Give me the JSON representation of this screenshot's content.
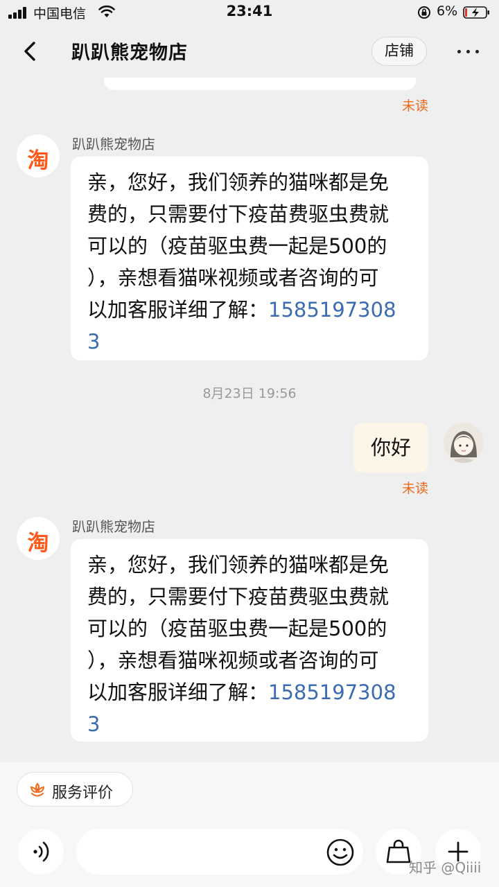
{
  "status_bar": {
    "carrier": "中国电信",
    "time": "23:41",
    "battery_percent": "6%"
  },
  "header": {
    "back_icon": "chevron-left-icon",
    "title": "趴趴熊宠物店",
    "store_button": "店铺",
    "more_icon": "more-dots-icon"
  },
  "chat": {
    "messages": [
      {
        "type": "status",
        "text": "未读"
      },
      {
        "type": "incoming",
        "sender": "趴趴熊宠物店",
        "avatar_text": "淘",
        "lines": [
          "亲，您好，我们领养的猫咪都是免",
          "费的，只需要付下疫苗费驱虫费就",
          "可以的（疫苗驱虫费一起是500的",
          "），亲想看猫咪视频或者咨询的可",
          "以加客服详细了解："
        ],
        "phone": "1585197308",
        "phone_tail": "3"
      },
      {
        "type": "timestamp",
        "text": "8月23日 19:56"
      },
      {
        "type": "outgoing",
        "text": "你好",
        "status": "未读"
      },
      {
        "type": "incoming",
        "sender": "趴趴熊宠物店",
        "avatar_text": "淘",
        "lines": [
          "亲，您好，我们领养的猫咪都是免",
          "费的，只需要付下疫苗费驱虫费就",
          "可以的（疫苗驱虫费一起是500的",
          "），亲想看猫咪视频或者咨询的可",
          "以加客服详细了解："
        ],
        "phone": "1585197308",
        "phone_tail": "3"
      }
    ]
  },
  "bottom": {
    "service_eval": "服务评价",
    "service_eval_icon": "flower-badge-icon",
    "voice_icon": "voice-icon",
    "emoji_icon": "smiley-icon",
    "bag_icon": "shopping-bag-icon",
    "plus_icon": "plus-icon",
    "watermark": "知乎 @Qiiii"
  },
  "colors": {
    "accent_orange": "#f06a1b",
    "link_blue": "#3b6bb0",
    "taobao_orange": "#ff5a1a"
  }
}
